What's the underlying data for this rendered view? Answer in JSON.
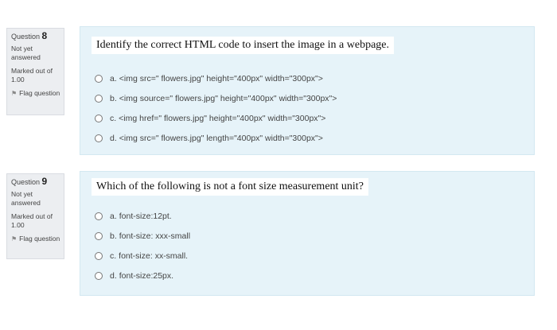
{
  "questions": [
    {
      "number_prefix": "Question",
      "number": "8",
      "state": "Not yet answered",
      "grade": "Marked out of 1.00",
      "flag_label": "Flag question",
      "text": "Identify the correct HTML code to insert the image in a webpage.",
      "options": [
        {
          "letter": "a.",
          "text": "<img src=\" flowers.jpg\" height=\"400px\" width=\"300px\">"
        },
        {
          "letter": "b.",
          "text": "<img source=\" flowers.jpg\" height=\"400px\" width=\"300px\">"
        },
        {
          "letter": "c.",
          "text": "<img href=\" flowers.jpg\" height=\"400px\" width=\"300px\">"
        },
        {
          "letter": "d.",
          "text": "<img src=\" flowers.jpg\" length=\"400px\" width=\"300px\">"
        }
      ]
    },
    {
      "number_prefix": "Question",
      "number": "9",
      "state": "Not yet answered",
      "grade": "Marked out of 1.00",
      "flag_label": "Flag question",
      "text": "Which of the following is not a font size measurement unit?",
      "options": [
        {
          "letter": "a.",
          "text": "font-size:12pt."
        },
        {
          "letter": "b.",
          "text": "font-size: xxx-small"
        },
        {
          "letter": "c.",
          "text": "font-size: xx-small."
        },
        {
          "letter": "d.",
          "text": "font-size:25px."
        }
      ]
    }
  ]
}
